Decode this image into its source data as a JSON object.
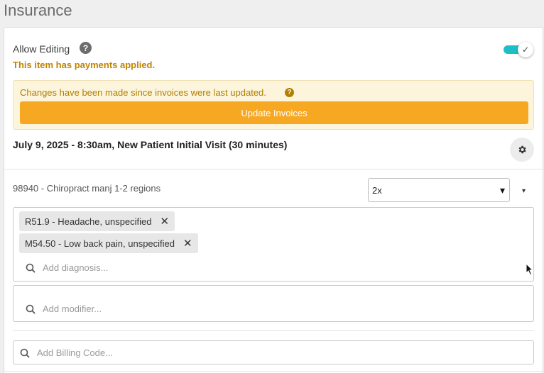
{
  "page": {
    "title": "Insurance"
  },
  "editing": {
    "label": "Allow Editing",
    "help_glyph": "?",
    "toggle_on": true,
    "toggle_glyph": "✓",
    "payments_warning": "This item has payments applied."
  },
  "notice": {
    "text": "Changes have been made since invoices were last updated.",
    "help_glyph": "?",
    "update_button": "Update Invoices"
  },
  "visit": {
    "title": "July 9, 2025 - 8:30am, New Patient Initial Visit (30 minutes)"
  },
  "procedure": {
    "label": "98940 - Chiropract manj 1-2 regions",
    "units": "2x",
    "units_caret": "▾",
    "menu_caret": "▾"
  },
  "diagnoses": {
    "items": [
      {
        "label": "R51.9 - Headache, unspecified",
        "remove": "✕"
      },
      {
        "label": "M54.50 - Low back pain, unspecified",
        "remove": "✕"
      }
    ],
    "placeholder": "Add diagnosis..."
  },
  "modifier": {
    "placeholder": "Add modifier..."
  },
  "billing": {
    "placeholder": "Add Billing Code..."
  },
  "colors": {
    "accent_orange": "#f7a823",
    "toggle_teal": "#1cbfc6",
    "warning_text": "#c08400",
    "notice_bg": "#fcf5dc"
  },
  "icons": [
    "help-icon",
    "check-icon",
    "gear-icon",
    "search-icon",
    "close-icon",
    "chevron-down-icon"
  ]
}
